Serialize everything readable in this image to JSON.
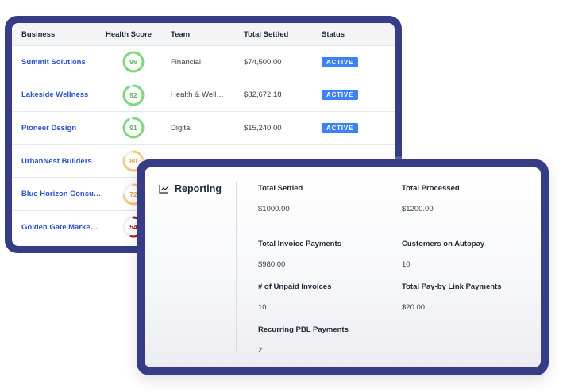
{
  "table": {
    "headers": {
      "business": "Business",
      "health_score": "Health Score",
      "team": "Team",
      "total_settled": "Total Settled",
      "status": "Status"
    },
    "rows": [
      {
        "business": "Summit Solutions",
        "score": "96",
        "score_pct": 0.96,
        "ring_color": "#7dd87d",
        "score_color": "#5cb85c",
        "team": "Financial",
        "total_settled": "$74,500.00",
        "status": "ACTIVE"
      },
      {
        "business": "Lakeside Wellness",
        "score": "92",
        "score_pct": 0.92,
        "ring_color": "#7dd87d",
        "score_color": "#5cb85c",
        "team": "Health & Well…",
        "total_settled": "$82,672.18",
        "status": "ACTIVE"
      },
      {
        "business": "Pioneer Design",
        "score": "91",
        "score_pct": 0.91,
        "ring_color": "#7dd87d",
        "score_color": "#5cb85c",
        "team": "Digital",
        "total_settled": "$15,240.00",
        "status": "ACTIVE"
      },
      {
        "business": "UrbanNest Builders",
        "score": "80",
        "score_pct": 0.8,
        "ring_color": "#f7c77a",
        "score_color": "#e0a84a",
        "team": "",
        "total_settled": "",
        "status": ""
      },
      {
        "business": "Blue Horizon Consu…",
        "score": "72",
        "score_pct": 0.72,
        "ring_color": "#f7c77a",
        "score_color": "#e0a84a",
        "team": "",
        "total_settled": "",
        "status": ""
      },
      {
        "business": "Golden Gate Marke…",
        "score": "54",
        "score_pct": 0.54,
        "ring_color": "#9b1c2e",
        "score_color": "#9b1c2e",
        "team": "",
        "total_settled": "",
        "status": ""
      }
    ]
  },
  "reporting": {
    "title": "Reporting",
    "icon": "line-chart-icon",
    "metrics": [
      {
        "label": "Total Settled",
        "value": "$1000.00"
      },
      {
        "label": "Total Processed",
        "value": "$1200.00"
      },
      {
        "label": "Total Invoice Payments",
        "value": "$980.00"
      },
      {
        "label": "Customers on Autopay",
        "value": "10"
      },
      {
        "label": "# of Unpaid Invoices",
        "value": "10"
      },
      {
        "label": "Total Pay-by Link Payments",
        "value": "$20.00"
      },
      {
        "label": "Recurring PBL Payments",
        "value": "2"
      }
    ]
  },
  "colors": {
    "frame": "#373d85",
    "link": "#2b54c9",
    "badge": "#3b82f6"
  }
}
